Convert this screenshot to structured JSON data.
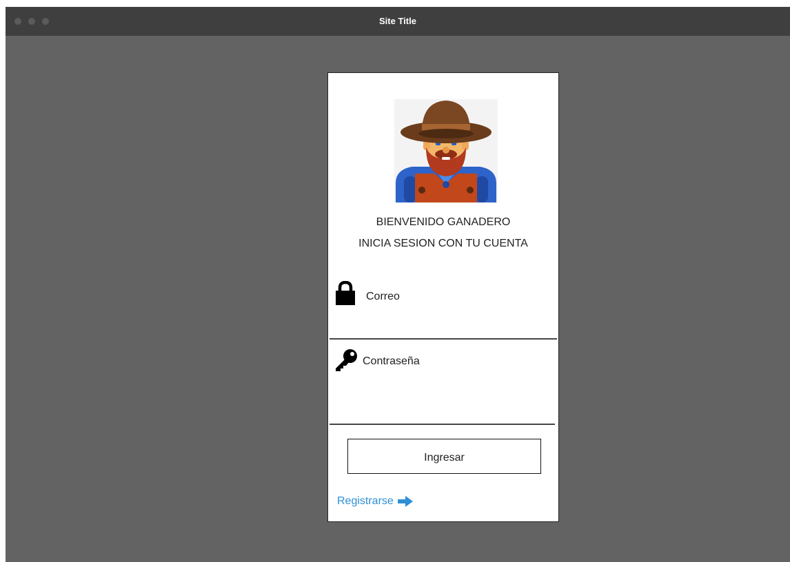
{
  "window": {
    "title": "Site Title"
  },
  "login": {
    "avatar_icon": "farmer-avatar-icon",
    "welcome_line1": "BIENVENIDO GANADERO",
    "welcome_line2": "INICIA SESION CON TU CUENTA",
    "email": {
      "icon": "lock-icon",
      "label": "Correo",
      "value": ""
    },
    "password": {
      "icon": "key-icon",
      "label": "Contraseña",
      "value": ""
    },
    "submit_label": "Ingresar",
    "register_label": "Registrarse",
    "register_icon": "arrow-right-icon",
    "link_color": "#2e8fd6"
  }
}
